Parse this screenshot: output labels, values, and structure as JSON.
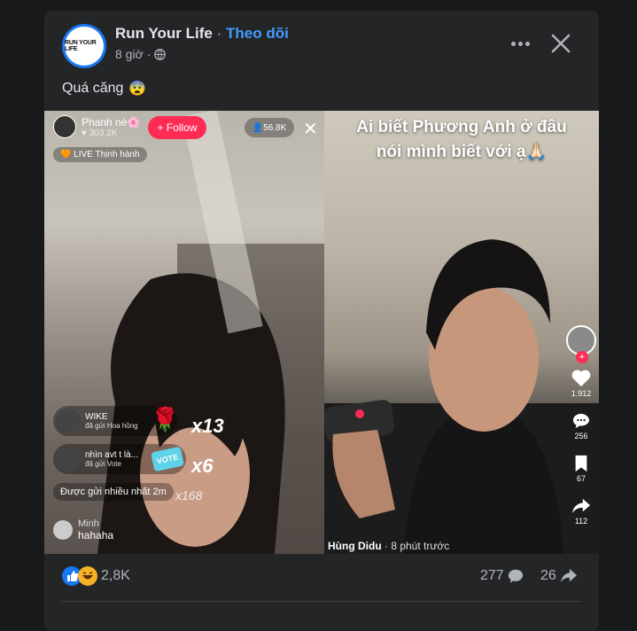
{
  "post": {
    "page_name": "Run Your Life",
    "separator": "·",
    "follow_label": "Theo dõi",
    "time": "8 giờ",
    "avatar_text": "RUN YOUR LIFE",
    "caption": "Quá căng",
    "caption_emoji": "😨"
  },
  "left_video": {
    "host_name": "Phanh nè🌸",
    "host_likes": "303.2K",
    "follow_label": "+ Follow",
    "viewers": "56.8K",
    "close": "✕",
    "live_badge": "🧡 LIVE Thịnh hành",
    "gifts": [
      {
        "name": "WIKE",
        "sub": "đã gửi Hoa hồng",
        "count": "x13"
      },
      {
        "name": "nhìn avt t là...",
        "sub": "đã gửi Vote",
        "count": "x6"
      }
    ],
    "gift_note": "Được gửi nhiều nhất 2m",
    "gift_extra": "x168",
    "comment_name": "Minh",
    "comment_text": "hahaha"
  },
  "right_video": {
    "title_line1": "Ai biết Phương Anh ở đâu",
    "title_line2": "nói mình biết với ạ🙏🏻",
    "likes": "1.912",
    "comments": "256",
    "saves": "67",
    "shares": "112",
    "user": "Hùng Didu",
    "user_time": "· 8 phút trước"
  },
  "footer": {
    "reaction_count": "2,8K",
    "comment_count": "277",
    "share_count": "26"
  },
  "colors": {
    "background": "#18191a",
    "card": "#242526",
    "accent": "#4599ff",
    "text": "#e4e6eb",
    "muted": "#b0b3b8",
    "tiktok_red": "#fe2c55"
  }
}
